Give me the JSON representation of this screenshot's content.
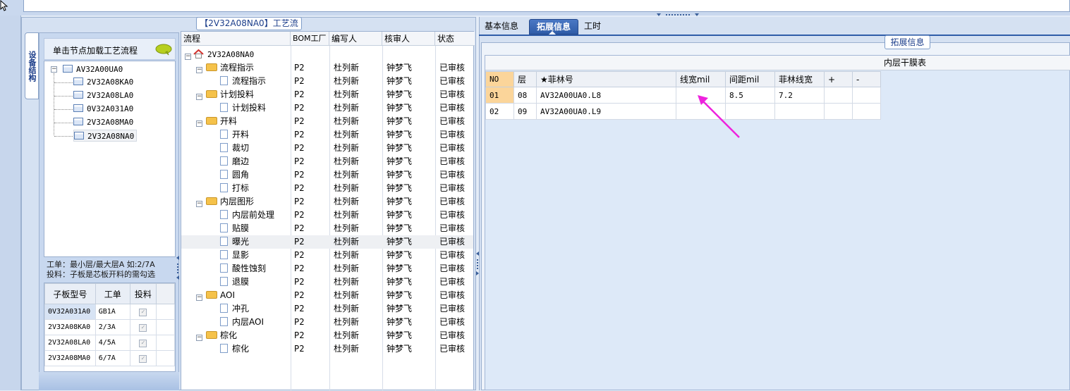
{
  "window": {
    "panel_title": "【2V32A08NA0】工艺流程",
    "vertical_tab": "设备结构"
  },
  "device_tree": {
    "hint": "单击节点加载工艺流程",
    "root": "AV32A00UA0",
    "children": [
      "2V32A08KA0",
      "2V32A08LA0",
      "0V32A031A0",
      "2V32A08MA0",
      "2V32A08NA0"
    ]
  },
  "note": {
    "line1": "工单：最小层/最大层A 如:2/7A",
    "line2": "投料：子板是芯板开料的需勾选"
  },
  "sub_table": {
    "headers": [
      "子板型号",
      "工单",
      "投料"
    ],
    "rows": [
      {
        "model": "0V32A031A0",
        "order": "GB1A",
        "feed": "✓"
      },
      {
        "model": "2V32A08KA0",
        "order": "2/3A",
        "feed": "✓"
      },
      {
        "model": "2V32A08LA0",
        "order": "4/5A",
        "feed": "✓"
      },
      {
        "model": "2V32A08MA0",
        "order": "6/7A",
        "feed": "✓"
      }
    ]
  },
  "process": {
    "headers": [
      "流程",
      "BOM工厂",
      "编写人",
      "核审人",
      "状态"
    ],
    "root": "2V32A08NA0",
    "rows": [
      {
        "label": "流程指示",
        "level": 1,
        "type": "folder",
        "bom": "P2",
        "writer": "杜列新",
        "reviewer": "钟梦飞",
        "status": "已审核"
      },
      {
        "label": "流程指示",
        "level": 2,
        "type": "doc",
        "bom": "P2",
        "writer": "杜列新",
        "reviewer": "钟梦飞",
        "status": "已审核"
      },
      {
        "label": "计划投料",
        "level": 1,
        "type": "folder",
        "bom": "P2",
        "writer": "杜列新",
        "reviewer": "钟梦飞",
        "status": "已审核"
      },
      {
        "label": "计划投料",
        "level": 2,
        "type": "doc",
        "bom": "P2",
        "writer": "杜列新",
        "reviewer": "钟梦飞",
        "status": "已审核"
      },
      {
        "label": "开料",
        "level": 1,
        "type": "folder",
        "bom": "P2",
        "writer": "杜列新",
        "reviewer": "钟梦飞",
        "status": "已审核"
      },
      {
        "label": "开料",
        "level": 2,
        "type": "doc",
        "bom": "P2",
        "writer": "杜列新",
        "reviewer": "钟梦飞",
        "status": "已审核"
      },
      {
        "label": "裁切",
        "level": 2,
        "type": "doc",
        "bom": "P2",
        "writer": "杜列新",
        "reviewer": "钟梦飞",
        "status": "已审核"
      },
      {
        "label": "磨边",
        "level": 2,
        "type": "doc",
        "bom": "P2",
        "writer": "杜列新",
        "reviewer": "钟梦飞",
        "status": "已审核"
      },
      {
        "label": "圆角",
        "level": 2,
        "type": "doc",
        "bom": "P2",
        "writer": "杜列新",
        "reviewer": "钟梦飞",
        "status": "已审核"
      },
      {
        "label": "打标",
        "level": 2,
        "type": "doc",
        "bom": "P2",
        "writer": "杜列新",
        "reviewer": "钟梦飞",
        "status": "已审核"
      },
      {
        "label": "内层图形",
        "level": 1,
        "type": "folder",
        "bom": "P2",
        "writer": "杜列新",
        "reviewer": "钟梦飞",
        "status": "已审核"
      },
      {
        "label": "内层前处理",
        "level": 2,
        "type": "doc",
        "bom": "P2",
        "writer": "杜列新",
        "reviewer": "钟梦飞",
        "status": "已审核"
      },
      {
        "label": "贴膜",
        "level": 2,
        "type": "doc",
        "bom": "P2",
        "writer": "杜列新",
        "reviewer": "钟梦飞",
        "status": "已审核"
      },
      {
        "label": "曝光",
        "level": 2,
        "type": "doc",
        "bom": "P2",
        "writer": "杜列新",
        "reviewer": "钟梦飞",
        "status": "已审核"
      },
      {
        "label": "显影",
        "level": 2,
        "type": "doc",
        "bom": "P2",
        "writer": "杜列新",
        "reviewer": "钟梦飞",
        "status": "已审核"
      },
      {
        "label": "酸性蚀刻",
        "level": 2,
        "type": "doc",
        "bom": "P2",
        "writer": "杜列新",
        "reviewer": "钟梦飞",
        "status": "已审核"
      },
      {
        "label": "退膜",
        "level": 2,
        "type": "doc",
        "bom": "P2",
        "writer": "杜列新",
        "reviewer": "钟梦飞",
        "status": "已审核"
      },
      {
        "label": "AOI",
        "level": 1,
        "type": "folder",
        "bom": "P2",
        "writer": "杜列新",
        "reviewer": "钟梦飞",
        "status": "已审核"
      },
      {
        "label": "冲孔",
        "level": 2,
        "type": "doc",
        "bom": "P2",
        "writer": "杜列新",
        "reviewer": "钟梦飞",
        "status": "已审核"
      },
      {
        "label": "内层AOI",
        "level": 2,
        "type": "doc",
        "bom": "P2",
        "writer": "杜列新",
        "reviewer": "钟梦飞",
        "status": "已审核"
      },
      {
        "label": "棕化",
        "level": 1,
        "type": "folder",
        "bom": "P2",
        "writer": "杜列新",
        "reviewer": "钟梦飞",
        "status": "已审核"
      },
      {
        "label": "棕化",
        "level": 2,
        "type": "doc",
        "bom": "P2",
        "writer": "杜列新",
        "reviewer": "钟梦飞",
        "status": "已审核"
      }
    ]
  },
  "tabs": {
    "basic": "基本信息",
    "extended": "拓展信息",
    "hours": "工时"
  },
  "ext": {
    "group_title": "拓展信息",
    "grid_caption": "内层干膜表",
    "headers": [
      "NO",
      "层",
      "★菲林号",
      "线宽mil",
      "间距mil",
      "菲林线宽",
      "+",
      "-"
    ],
    "rows": [
      {
        "no": "01",
        "layer": "08",
        "film": "AV32A00UA0.L8",
        "width": "",
        "spacing": "8.5",
        "film_width": "7.2"
      },
      {
        "no": "02",
        "layer": "09",
        "film": "AV32A00UA0.L9",
        "width": "",
        "spacing": "",
        "film_width": ""
      }
    ]
  },
  "colors": {
    "accent": "#2f5ca8",
    "annotation_arrow": "#ee22dd",
    "selected_cell": "#fbd59a"
  }
}
